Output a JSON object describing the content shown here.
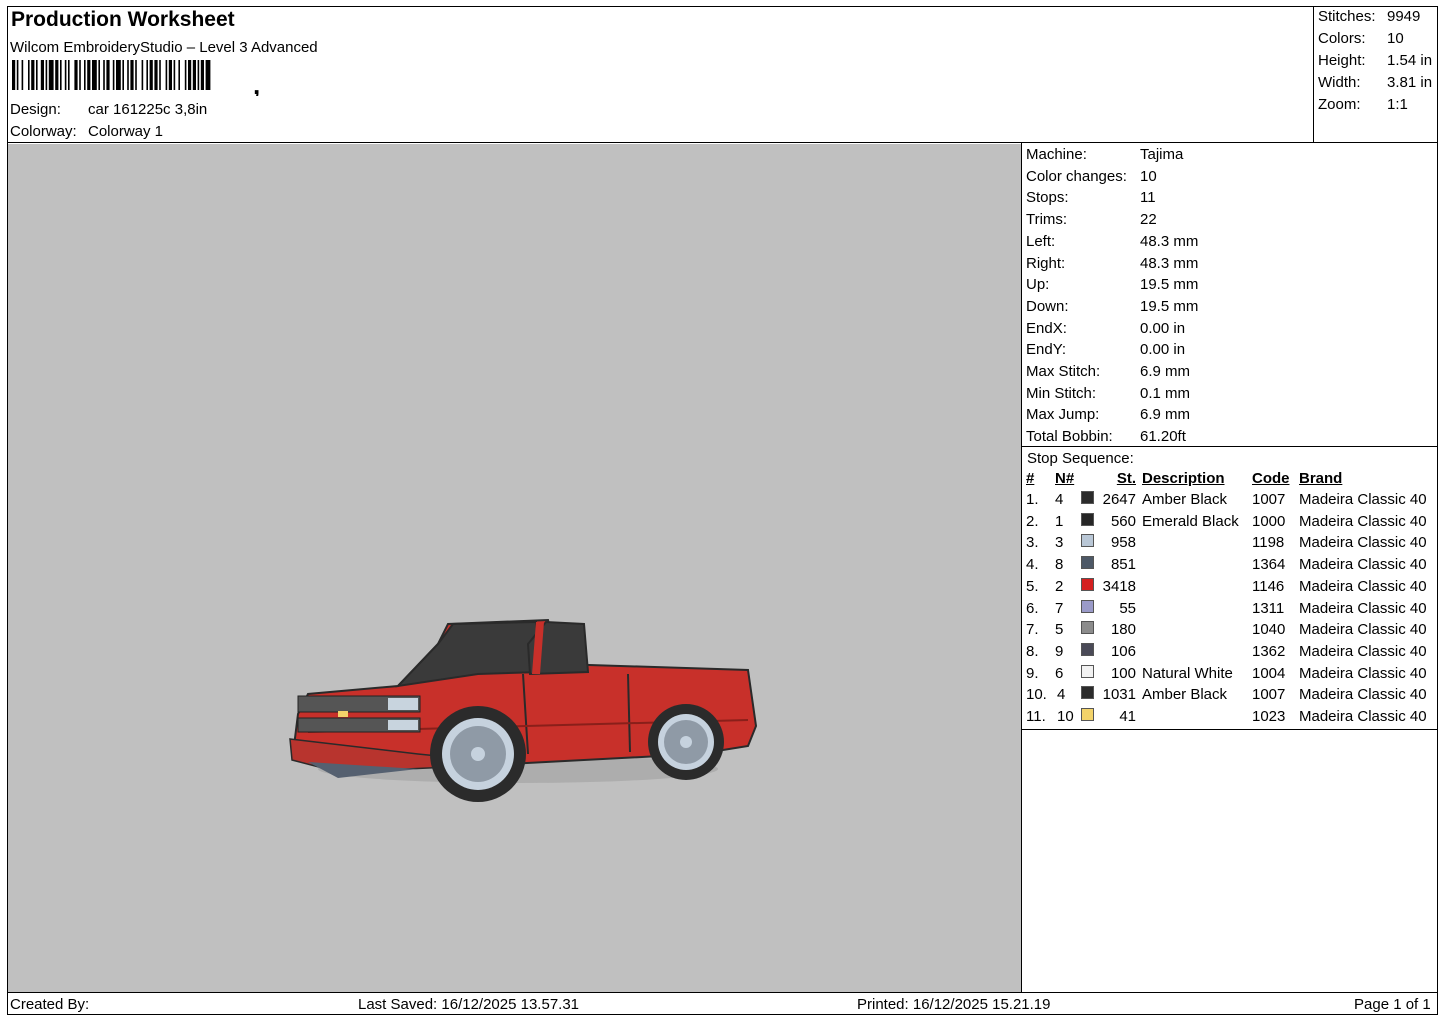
{
  "header": {
    "title": "Production Worksheet",
    "software": "Wilcom EmbroideryStudio – Level 3 Advanced",
    "design_label": "Design:",
    "design_value": "car 161225c 3,8in",
    "colorway_label": "Colorway:",
    "colorway_value": "Colorway 1"
  },
  "summary": [
    {
      "label": "Stitches:",
      "value": "9949"
    },
    {
      "label": "Colors:",
      "value": "10"
    },
    {
      "label": "Height:",
      "value": "1.54 in"
    },
    {
      "label": "Width:",
      "value": "3.81 in"
    },
    {
      "label": "Zoom:",
      "value": "1:1"
    }
  ],
  "machine_stats": [
    {
      "label": "Machine:",
      "value": "Tajima"
    },
    {
      "label": "Color changes:",
      "value": "10"
    },
    {
      "label": "Stops:",
      "value": "11"
    },
    {
      "label": "Trims:",
      "value": "22"
    },
    {
      "label": "Left:",
      "value": "48.3 mm"
    },
    {
      "label": "Right:",
      "value": "48.3 mm"
    },
    {
      "label": "Up:",
      "value": "19.5 mm"
    },
    {
      "label": "Down:",
      "value": "19.5 mm"
    },
    {
      "label": "EndX:",
      "value": "0.00 in"
    },
    {
      "label": "EndY:",
      "value": "0.00 in"
    },
    {
      "label": "Max Stitch:",
      "value": "6.9 mm"
    },
    {
      "label": "Min Stitch:",
      "value": "0.1 mm"
    },
    {
      "label": "Max Jump:",
      "value": "6.9 mm"
    },
    {
      "label": "Total Bobbin:",
      "value": "61.20ft"
    }
  ],
  "stop_sequence": {
    "title": "Stop Sequence:",
    "headers": {
      "num": "#",
      "needle": "N#",
      "stitches": "St.",
      "description": "Description",
      "code": "Code",
      "brand": "Brand"
    },
    "rows": [
      {
        "num": "1.",
        "needle": "4",
        "color": "#2b2b2b",
        "stitches": "2647",
        "description": "Amber Black",
        "code": "1007",
        "brand": "Madeira Classic 40"
      },
      {
        "num": "2.",
        "needle": "1",
        "color": "#262626",
        "stitches": "560",
        "description": "Emerald Black",
        "code": "1000",
        "brand": "Madeira Classic 40"
      },
      {
        "num": "3.",
        "needle": "3",
        "color": "#b9c7d6",
        "stitches": "958",
        "description": "",
        "code": "1198",
        "brand": "Madeira Classic 40"
      },
      {
        "num": "4.",
        "needle": "8",
        "color": "#4d5866",
        "stitches": "851",
        "description": "",
        "code": "1364",
        "brand": "Madeira Classic 40"
      },
      {
        "num": "5.",
        "needle": "2",
        "color": "#d41f1f",
        "stitches": "3418",
        "description": "",
        "code": "1146",
        "brand": "Madeira Classic 40"
      },
      {
        "num": "6.",
        "needle": "7",
        "color": "#9a9ac8",
        "stitches": "55",
        "description": "",
        "code": "1311",
        "brand": "Madeira Classic 40"
      },
      {
        "num": "7.",
        "needle": "5",
        "color": "#8c8c8c",
        "stitches": "180",
        "description": "",
        "code": "1040",
        "brand": "Madeira Classic 40"
      },
      {
        "num": "8.",
        "needle": "9",
        "color": "#4a4a57",
        "stitches": "106",
        "description": "",
        "code": "1362",
        "brand": "Madeira Classic 40"
      },
      {
        "num": "9.",
        "needle": "6",
        "color": "#f2f2f2",
        "stitches": "100",
        "description": "Natural White",
        "code": "1004",
        "brand": "Madeira Classic 40"
      },
      {
        "num": "10.",
        "needle": "4",
        "color": "#2b2b2b",
        "stitches": "1031",
        "description": "Amber Black",
        "code": "1007",
        "brand": "Madeira Classic 40"
      },
      {
        "num": "11.",
        "needle": "10",
        "color": "#f3d36a",
        "stitches": "41",
        "description": "",
        "code": "1023",
        "brand": "Madeira Classic 40"
      }
    ]
  },
  "footer": {
    "created_by": "Created By:",
    "last_saved": "Last Saved: 16/12/2025 13.57.31",
    "printed": "Printed: 16/12/2025 15.21.19",
    "page": "Page 1 of 1"
  },
  "colors": {
    "canvas_bg": "#c0c0c0",
    "truck_body": "#c8302a"
  }
}
